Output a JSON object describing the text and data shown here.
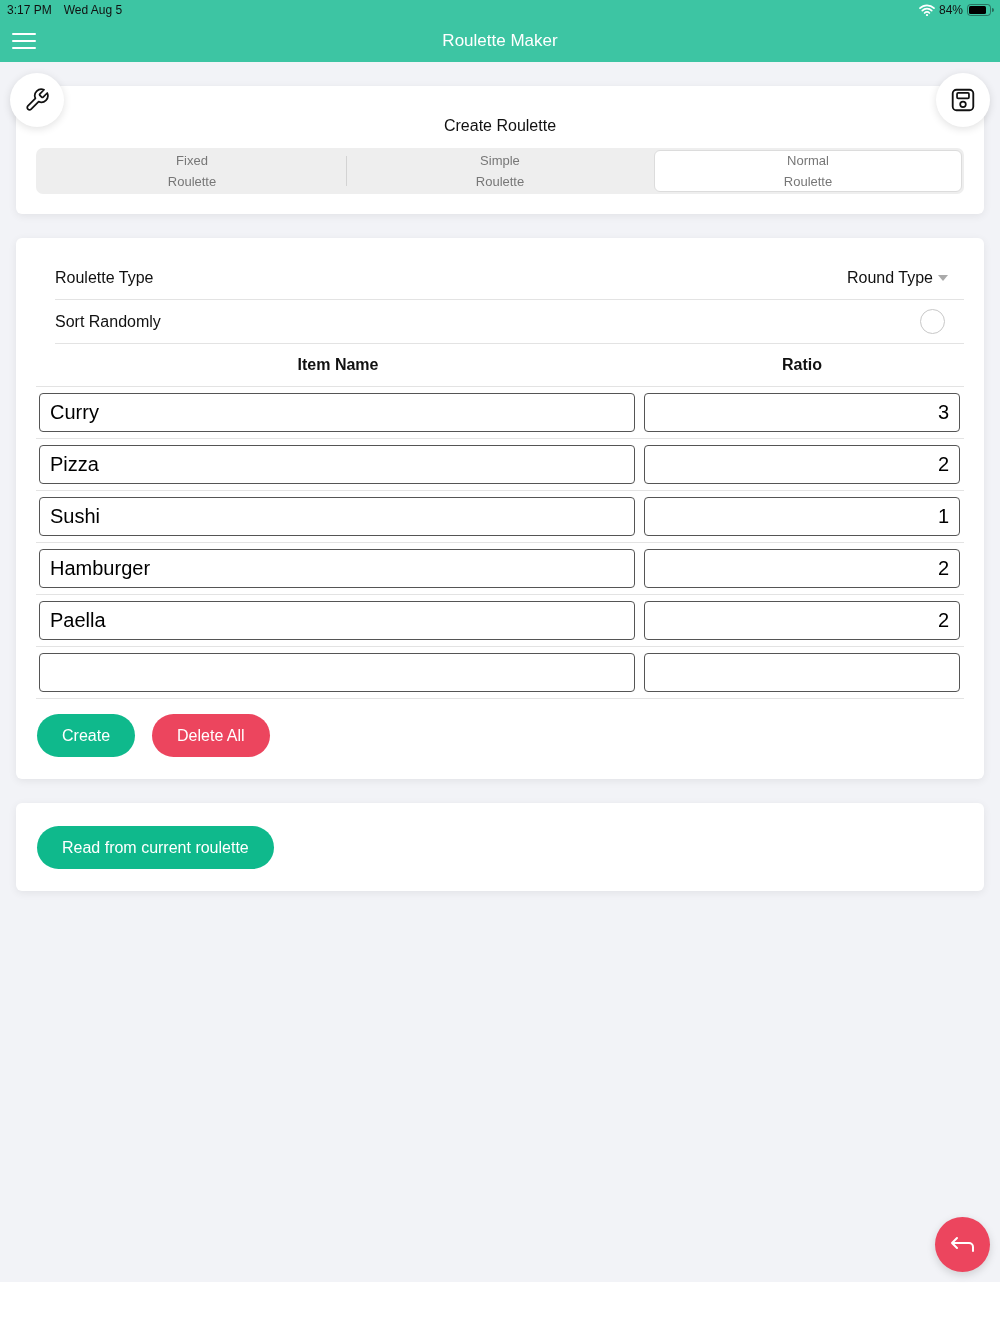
{
  "status_bar": {
    "time": "3:17 PM",
    "date": "Wed Aug 5",
    "battery": "84%"
  },
  "nav_bar": {
    "title": "Roulette Maker"
  },
  "create_card": {
    "title": "Create Roulette",
    "segments": [
      {
        "label": "Fixed Roulette",
        "selected": false
      },
      {
        "label": "Simple Roulette",
        "selected": false
      },
      {
        "label": "Normal Roulette",
        "selected": true
      }
    ]
  },
  "roulette_type": {
    "label": "Roulette Type",
    "value": "Round Type"
  },
  "sort_randomly": {
    "label": "Sort Randomly",
    "checked": false
  },
  "table": {
    "columns": [
      "Item Name",
      "Ratio"
    ],
    "rows": [
      {
        "item_name": "Curry",
        "ratio": "3"
      },
      {
        "item_name": "Pizza",
        "ratio": "2"
      },
      {
        "item_name": "Sushi",
        "ratio": "1"
      },
      {
        "item_name": "Hamburger",
        "ratio": "2"
      },
      {
        "item_name": "Paella",
        "ratio": "2"
      },
      {}
    ]
  },
  "buttons": [
    {
      "kind": "primary",
      "label": "Create"
    },
    {
      "kind": "danger",
      "label": "Delete All"
    }
  ],
  "read_button": {
    "label": "Read from current roulette"
  }
}
